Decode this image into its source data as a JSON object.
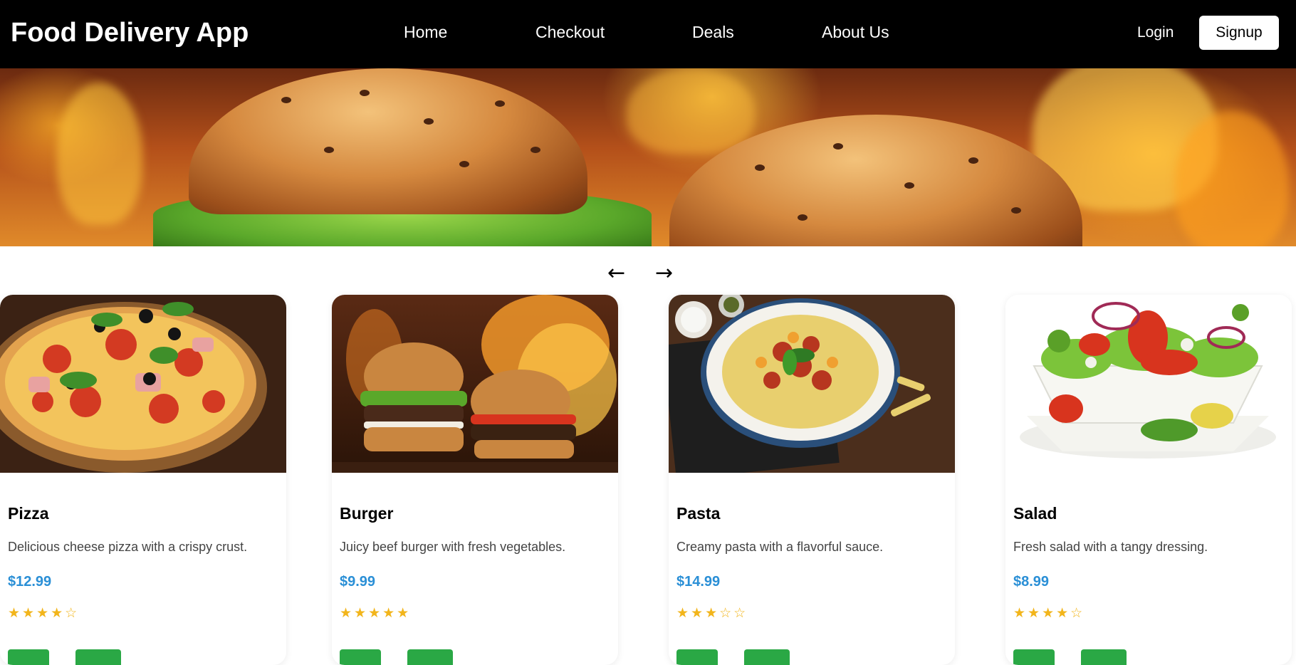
{
  "header": {
    "brand": "Food Delivery App",
    "nav": [
      "Home",
      "Checkout",
      "Deals",
      "About Us"
    ],
    "login": "Login",
    "signup": "Signup"
  },
  "carousel": {
    "prev_arrow": "←",
    "next_arrow": "→"
  },
  "products": [
    {
      "name": "Pizza",
      "description": "Delicious cheese pizza with a crispy crust.",
      "price": "$12.99",
      "stars": "★★★★☆",
      "rating": 4
    },
    {
      "name": "Burger",
      "description": "Juicy beef burger with fresh vegetables.",
      "price": "$9.99",
      "stars": "★★★★★",
      "rating": 5
    },
    {
      "name": "Pasta",
      "description": "Creamy pasta with a flavorful sauce.",
      "price": "$14.99",
      "stars": "★★★☆☆",
      "rating": 3
    },
    {
      "name": "Salad",
      "description": "Fresh salad with a tangy dressing.",
      "price": "$8.99",
      "stars": "★★★★☆",
      "rating": 4
    }
  ],
  "colors": {
    "navbar": "#000000",
    "price": "#2a8fd6",
    "star": "#f2b51b",
    "button": "#2aa845"
  }
}
